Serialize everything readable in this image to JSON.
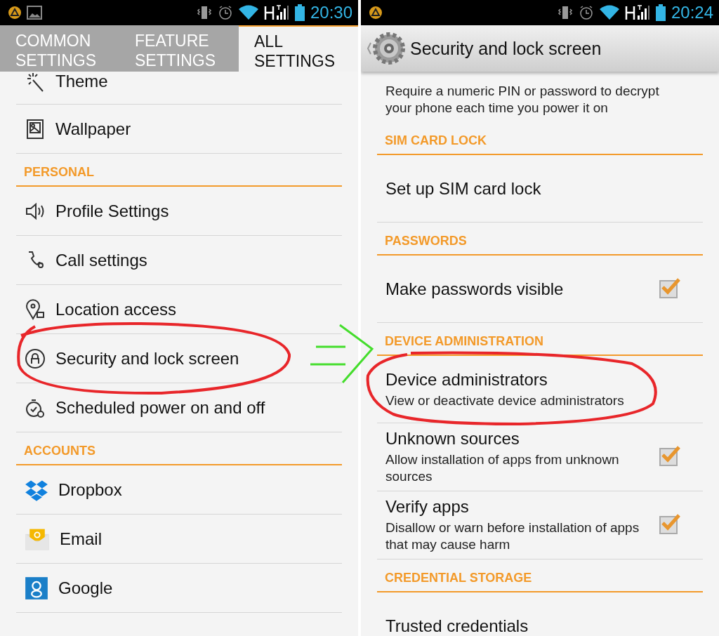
{
  "left": {
    "status_bar": {
      "time": "20:30"
    },
    "tabs": [
      {
        "label": "COMMON SETTINGS",
        "selected": false
      },
      {
        "label": "FEATURE SETTINGS",
        "selected": false
      },
      {
        "label": "ALL SETTINGS",
        "selected": true
      }
    ],
    "items": [
      {
        "kind": "item",
        "label": "Theme"
      },
      {
        "kind": "item",
        "label": "Wallpaper"
      },
      {
        "kind": "header",
        "label": "PERSONAL"
      },
      {
        "kind": "item",
        "label": "Profile Settings"
      },
      {
        "kind": "item",
        "label": "Call settings"
      },
      {
        "kind": "item",
        "label": "Location access"
      },
      {
        "kind": "item",
        "label": "Security and lock screen"
      },
      {
        "kind": "item",
        "label": "Scheduled power on and off"
      },
      {
        "kind": "header",
        "label": "ACCOUNTS"
      },
      {
        "kind": "item",
        "label": "Dropbox"
      },
      {
        "kind": "item",
        "label": "Email"
      },
      {
        "kind": "item",
        "label": "Google"
      }
    ]
  },
  "right": {
    "status_bar": {
      "time": "20:24"
    },
    "title": "Security and lock screen",
    "items": [
      {
        "kind": "summary",
        "summary": "Require a numeric PIN or password to decrypt your phone each time you power it on"
      },
      {
        "kind": "header",
        "label": "SIM CARD LOCK"
      },
      {
        "kind": "pref",
        "title": "Set up SIM card lock"
      },
      {
        "kind": "header",
        "label": "PASSWORDS"
      },
      {
        "kind": "pref",
        "title": "Make passwords visible",
        "checked": true
      },
      {
        "kind": "header",
        "label": "DEVICE ADMINISTRATION"
      },
      {
        "kind": "pref",
        "title": "Device administrators",
        "summary": "View or deactivate device administrators"
      },
      {
        "kind": "pref",
        "title": "Unknown sources",
        "summary": "Allow installation of apps from unknown sources",
        "checked": true
      },
      {
        "kind": "pref",
        "title": "Verify apps",
        "summary": "Disallow or warn before installation of apps that may cause harm",
        "checked": true
      },
      {
        "kind": "header",
        "label": "CREDENTIAL STORAGE"
      },
      {
        "kind": "pref",
        "title": "Trusted credentials"
      }
    ]
  }
}
